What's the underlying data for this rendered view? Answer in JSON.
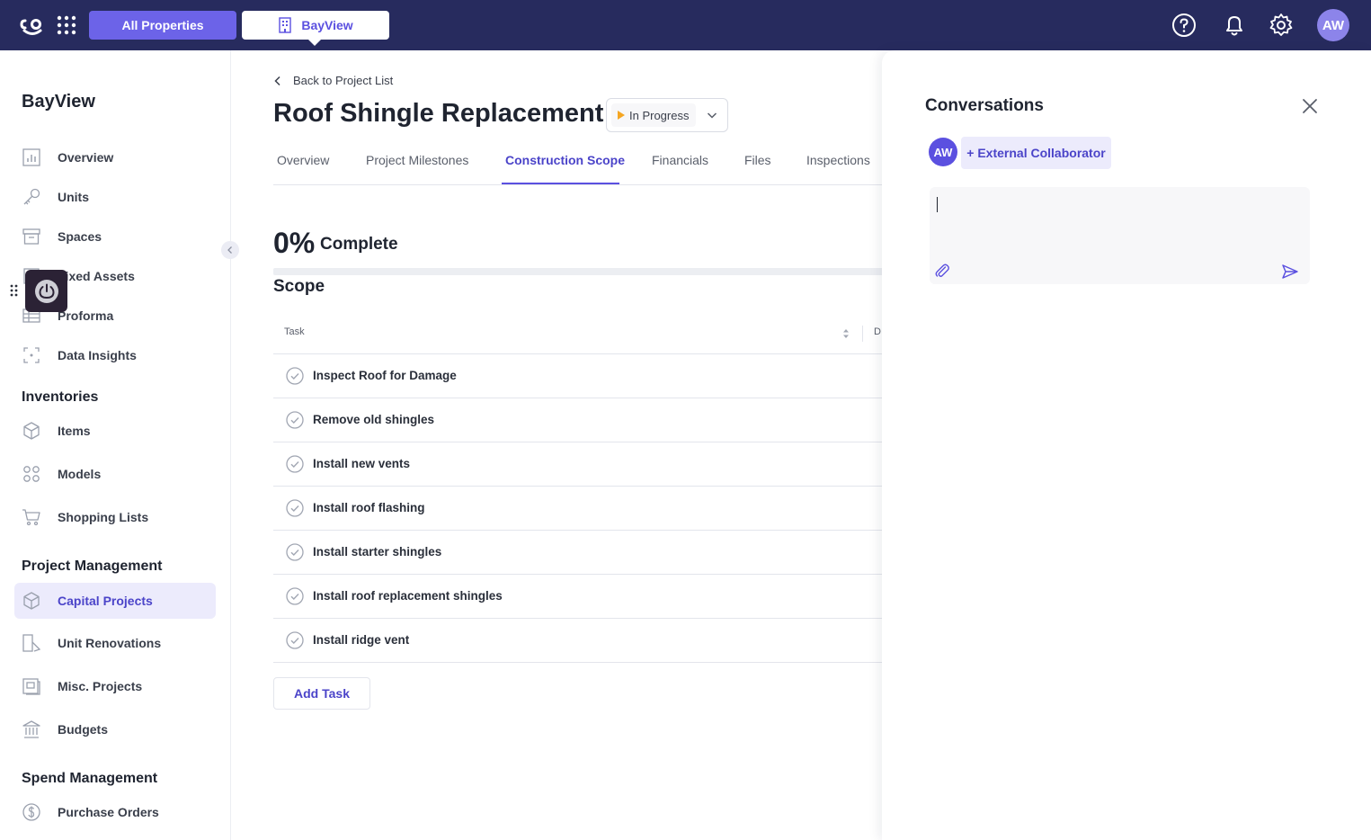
{
  "topbar": {
    "all_properties": "All Properties",
    "property": "BayView",
    "avatar": "AW",
    "colors": {
      "bg": "#272b5e",
      "accent": "#6c63e8"
    },
    "icons": [
      "logo-icon",
      "apps-grid-icon",
      "building-icon",
      "help-icon",
      "bell-icon",
      "gear-icon"
    ]
  },
  "sidebar": {
    "title": "BayView",
    "items_main": [
      {
        "label": "Overview",
        "icon": "chart-icon"
      },
      {
        "label": "Units",
        "icon": "key-icon"
      },
      {
        "label": "Spaces",
        "icon": "box-icon"
      },
      {
        "label": "Fixed Assets",
        "icon": "asset-icon"
      },
      {
        "label": "Proforma",
        "icon": "table-icon"
      },
      {
        "label": "Data Insights",
        "icon": "insights-icon"
      }
    ],
    "inventories": {
      "title": "Inventories",
      "items": [
        {
          "label": "Items",
          "icon": "cube-icon"
        },
        {
          "label": "Models",
          "icon": "grid-icon"
        },
        {
          "label": "Shopping Lists",
          "icon": "cart-icon"
        }
      ]
    },
    "project_management": {
      "title": "Project Management",
      "items": [
        {
          "label": "Capital Projects",
          "icon": "cube-icon",
          "active": true
        },
        {
          "label": "Unit Renovations",
          "icon": "renovation-icon"
        },
        {
          "label": "Misc. Projects",
          "icon": "misc-icon"
        },
        {
          "label": "Budgets",
          "icon": "bank-icon"
        }
      ]
    },
    "spend_management": {
      "title": "Spend Management",
      "items": [
        {
          "label": "Purchase Orders",
          "icon": "dollar-icon"
        }
      ]
    }
  },
  "main": {
    "back_link": "Back to Project List",
    "title": "Roof Shingle Replacement",
    "status": "In Progress",
    "tabs": [
      {
        "label": "Overview"
      },
      {
        "label": "Project Milestones"
      },
      {
        "label": "Construction Scope",
        "active": true
      },
      {
        "label": "Financials"
      },
      {
        "label": "Files"
      },
      {
        "label": "Inspections"
      }
    ],
    "progress": {
      "percent_label": "0%",
      "label": "Complete",
      "value": 0
    },
    "scope": {
      "title": "Scope",
      "columns": [
        "Task",
        "D"
      ],
      "tasks": [
        "Inspect Roof for Damage",
        "Remove old shingles",
        "Install new vents",
        "Install roof flashing",
        "Install starter shingles",
        "Install roof replacement shingles",
        "Install ridge vent"
      ]
    },
    "add_task": "Add Task"
  },
  "conversations": {
    "title": "Conversations",
    "avatar": "AW",
    "external_collaborator": "+ External Collaborator",
    "composer_value": ""
  }
}
